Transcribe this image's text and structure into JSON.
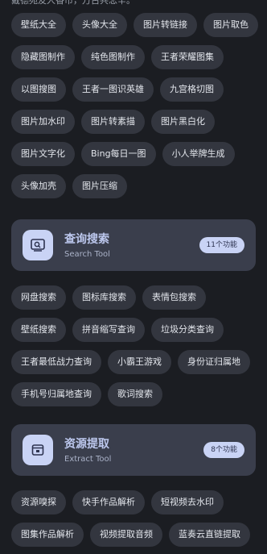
{
  "top_text": "戴德苑友人香市，万古共悲辛。",
  "group1": [
    "壁纸大全",
    "头像大全",
    "图片转链接",
    "图片取色",
    "隐藏图制作",
    "纯色图制作",
    "王者荣耀图集",
    "以图搜图",
    "王者一图识英雄",
    "九宫格切图",
    "图片加水印",
    "图片转素描",
    "图片黑白化",
    "图片文字化",
    "Bing每日一图",
    "小人举牌生成",
    "头像加壳",
    "图片压缩"
  ],
  "search_card": {
    "title": "查询搜索",
    "subtitle": "Search Tool",
    "badge": "11个功能",
    "icon": "search-window-icon"
  },
  "group2": [
    "网盘搜索",
    "图标库搜索",
    "表情包搜索",
    "壁纸搜索",
    "拼音缩写查询",
    "垃圾分类查询",
    "王者最低战力查询",
    "小霸王游戏",
    "身份证归属地",
    "手机号归属地查询",
    "歌词搜索"
  ],
  "extract_card": {
    "title": "资源提取",
    "subtitle": "Extract Tool",
    "badge": "8个功能",
    "icon": "extract-box-icon"
  },
  "group3": [
    "资源嗅探",
    "快手作品解析",
    "短视频去水印",
    "图集作品解析",
    "视频提取音频",
    "蓝奏云直链提取"
  ],
  "colors": {
    "background": "#1b1d22",
    "chip": "#33363f",
    "card": "#3a3e4c",
    "accent": "#c9d3f5"
  }
}
